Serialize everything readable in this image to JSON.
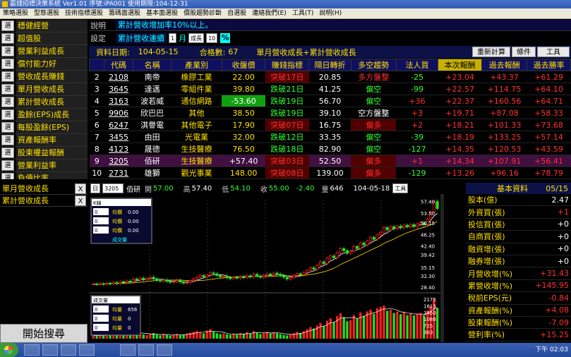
{
  "title": "贏錢招標決策系統 Ver1.01 序號:iPA001 使用期限:104-12-31",
  "menu": [
    "策略選股",
    "型態選股",
    "技術指標選股",
    "籌碼面選股",
    "基本面選股",
    "價股趨勢診斷",
    "自選股",
    "連絡我們(E)",
    "工具(T)",
    "說明(H)"
  ],
  "left_items": [
    "穩健經營",
    "超值股",
    "營業利益成長",
    "償付能力好",
    "營收成長賺錢",
    "單月營收成長",
    "累計營收成長",
    "盈餘(EPS)成長",
    "每股盈餘(EPS)",
    "資產報酬率",
    "股東權益報酬",
    "營業利益率",
    "負債比率"
  ],
  "left_sel": "選",
  "selected_list": [
    "單月營收成長",
    "累計營收成長"
  ],
  "x_label": "X",
  "search_button": "開始搜尋",
  "desc": {
    "label": "說明",
    "value": "累計營收增加率10%以上。"
  },
  "setting": {
    "label": "設定",
    "value": "累計營收連續",
    "n": "1",
    "unit": "月",
    "op": "成長",
    "val": "10",
    "pct": "%"
  },
  "info": {
    "date_label": "資料日期:",
    "date": "104-05-15",
    "count_label": "合格數:",
    "count": "67",
    "desc": "單月營收成長+累計營收成長",
    "btn1": "重新計算",
    "btn2": "條件",
    "btn3": "工具"
  },
  "columns": [
    "",
    "代碼",
    "名稱",
    "產業別",
    "收盤價",
    "賺錢指標",
    "隔日轉折",
    "多空趨勢",
    "法人買",
    "本次報酬",
    "過去報酬",
    "過去勝率"
  ],
  "rows": [
    [
      "2",
      "2108",
      "南帝",
      "橡膠工業",
      "22.00",
      "突破17日",
      "20.85",
      "多方盤整",
      "-25",
      "+23.04",
      "+43.37",
      "+61.29"
    ],
    [
      "3",
      "3645",
      "達邁",
      "零組件業",
      "39.80",
      "跌破21日",
      "41.25",
      "偏空",
      "-99",
      "+22.57",
      "+114.75",
      "+64.10"
    ],
    [
      "4",
      "3163",
      "波若威",
      "通信網路",
      "-53.60",
      "跌破19日",
      "56.70",
      "偏空",
      "+36",
      "+22.37",
      "+160.56",
      "+64.71"
    ],
    [
      "5",
      "9906",
      "欣巴巴",
      "其他",
      "38.50",
      "跌破19日",
      "39.10",
      "空方盤整",
      "+3",
      "+19.71",
      "+87.08",
      "+58.33"
    ],
    [
      "6",
      "6247",
      "淇譽電",
      "其他電子",
      "17.90",
      "突破07日",
      "16.75",
      "偏多",
      "+2",
      "+18.21",
      "+101.33",
      "+73.68"
    ],
    [
      "7",
      "3455",
      "由田",
      "光電業",
      "32.00",
      "跌破12日",
      "33.35",
      "偏空",
      "-39",
      "+18.19",
      "+133.25",
      "+57.14"
    ],
    [
      "8",
      "4123",
      "晟德",
      "生技醫療",
      "76.50",
      "跌破18日",
      "82.90",
      "偏空",
      "-127",
      "+14.35",
      "+120.53",
      "+43.59"
    ],
    [
      "9",
      "3205",
      "佰研",
      "生技醫療",
      "+57.40",
      "突破03日",
      "52.50",
      "偏多",
      "+1",
      "+14.34",
      "+107.91",
      "+56.41"
    ],
    [
      "10",
      "2731",
      "雄獅",
      "觀光事業",
      "148.00",
      "突破08日",
      "139.00",
      "偏多",
      "-129",
      "+13.26",
      "+96.16",
      "+78.79"
    ]
  ],
  "quote": {
    "period": "日",
    "code": "3205",
    "name": "佰研",
    "open_l": "開",
    "open": "57.00",
    "high_l": "高",
    "high": "57.40",
    "low_l": "低",
    "low": "54.10",
    "close_l": "收",
    "close": "55.00",
    "chg": "-2.40",
    "vol_l": "量",
    "vol": "646",
    "date": "104-05-18",
    "tool": "工具"
  },
  "ma_panel": {
    "title": "K線",
    "label": "均價",
    "rows": [
      "0.00",
      "0.00",
      "0.00"
    ],
    "field": "0",
    "footer": "成交量"
  },
  "vol_panel": {
    "title": "成交量",
    "label": "均量",
    "rows": [
      "656",
      "0",
      "0"
    ],
    "field": "0"
  },
  "y_ticks": [
    "57.40",
    "53.50",
    "50.15",
    "46.25",
    "42.40",
    "39.42",
    "35.15",
    "32.30",
    "28.40"
  ],
  "v_ticks": [
    "2175",
    "1813",
    "1450",
    "1088",
    "725",
    "363"
  ],
  "right": {
    "title": "基本資料",
    "date": "05/15",
    "items": [
      [
        "股本(億)",
        "2.47"
      ],
      [
        "外資買(張)",
        "+1"
      ],
      [
        "投信買(張)",
        "+0"
      ],
      [
        "自商買(張)",
        "+0"
      ],
      [
        "融資增(張)",
        "+0"
      ],
      [
        "融券增(張)",
        "+0"
      ],
      [
        "月營收增(%)",
        "+31.43"
      ],
      [
        "累營收增(%)",
        "+145.95"
      ],
      [
        "稅前EPS(元)",
        "-0.84"
      ],
      [
        "資產報酬(%)",
        "+4.08"
      ],
      [
        "股東報酬(%)",
        "-7.09"
      ],
      [
        "營利率(%)",
        "+15.25"
      ]
    ]
  },
  "clock": "下午 02:03",
  "candles": [
    29.5,
    29.4,
    29.6,
    29.5,
    29.8,
    29.6,
    30.0,
    29.7,
    30.3,
    30.1,
    30.5,
    30.2,
    31.2,
    30.9,
    31.5,
    31.0,
    31.4,
    31.8,
    31.2,
    30.8,
    30.5,
    30.9,
    30.4,
    30.1,
    30.3,
    30.7,
    30.2,
    29.8,
    30.0,
    30.6,
    31.2,
    31.8,
    32.4,
    31.9,
    32.5,
    33.3,
    33.0,
    32.4,
    31.9,
    32.2,
    31.6,
    31.3,
    31.8,
    31.5,
    32.0,
    31.7,
    32.3,
    31.9,
    32.8,
    32.2,
    31.8,
    32.4,
    32.9,
    32.5,
    33.2,
    32.8,
    32.3,
    31.8,
    31.2,
    31.7,
    32.4,
    33.0,
    32.6,
    33.4,
    34.1,
    35.0,
    34.5,
    35.8,
    37.0,
    36.4,
    38.2,
    39.0,
    38.4,
    40.1,
    41.5,
    40.8,
    39.9,
    40.6,
    42.2,
    41.5,
    43.4,
    42.7,
    44.0,
    45.3,
    44.6,
    46.1,
    47.0,
    48.6,
    47.8,
    48.9,
    48.2,
    49.1,
    48.5,
    49.4,
    48.8,
    49.6,
    48.9,
    49.8,
    50.2,
    49.5,
    51.5,
    53.8,
    57.4,
    55.0
  ],
  "volumes": [
    180,
    140,
    220,
    160,
    250,
    190,
    300,
    210,
    260,
    180,
    320,
    240,
    410,
    350,
    280,
    230,
    190,
    260,
    300,
    220,
    180,
    240,
    200,
    170,
    210,
    260,
    190,
    230,
    280,
    330,
    380,
    420,
    360,
    300,
    450,
    520,
    380,
    300,
    260,
    290,
    240,
    210,
    260,
    230,
    300,
    270,
    350,
    280,
    420,
    330,
    260,
    310,
    370,
    290,
    350,
    300,
    250,
    210,
    180,
    230,
    300,
    380,
    320,
    410,
    520,
    640,
    560,
    720,
    860,
    700,
    980,
    1120,
    900,
    1240,
    1400,
    1180,
    960,
    1020,
    1300,
    1100,
    1450,
    1260,
    1500,
    1600,
    1380,
    1680,
    1750,
    1820,
    1540,
    1600,
    1420,
    1500,
    1350,
    1480,
    1300,
    1400,
    1280,
    1360,
    1420,
    1300,
    1560,
    1800,
    2175,
    1700
  ]
}
